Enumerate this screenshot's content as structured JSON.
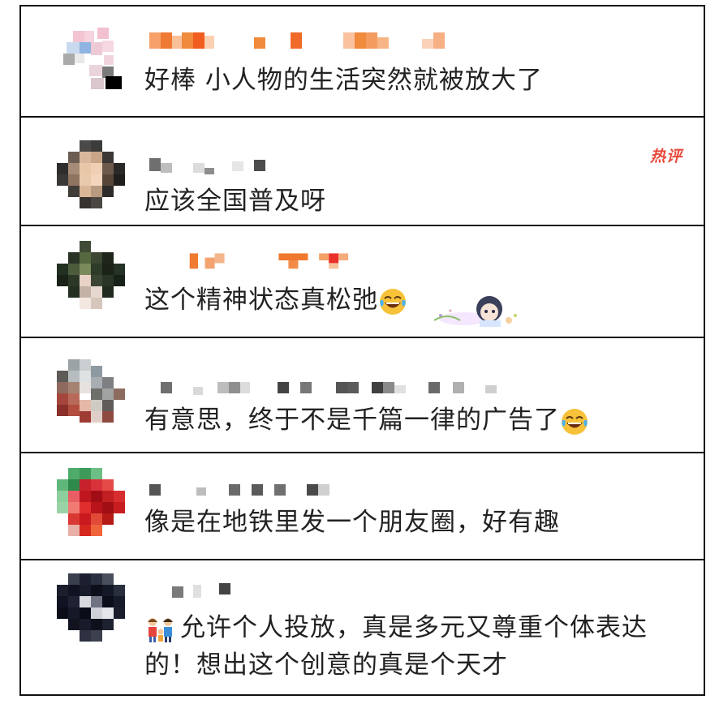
{
  "comments": [
    {
      "text": "好棒 小人物的生活突然就被放大了"
    },
    {
      "text": "应该全国普及呀",
      "tag": "热评"
    },
    {
      "text": "这个精神状态真松弛",
      "emoji": "laughing-tears"
    },
    {
      "text": "有意思，终于不是千篇一律的广告了",
      "emoji": "laughing-tears"
    },
    {
      "text": "像是在地铁里发一个朋友圈，好有趣"
    },
    {
      "text": "允许个人投放，真是多元又尊重个体表达的！想出这个创意的真是个天才",
      "icon": "family"
    }
  ],
  "colors": {
    "hot_tag": "#e64a3b",
    "text": "#222222",
    "border": "#111111",
    "name_mosaic_orange": "#f08a3c"
  }
}
